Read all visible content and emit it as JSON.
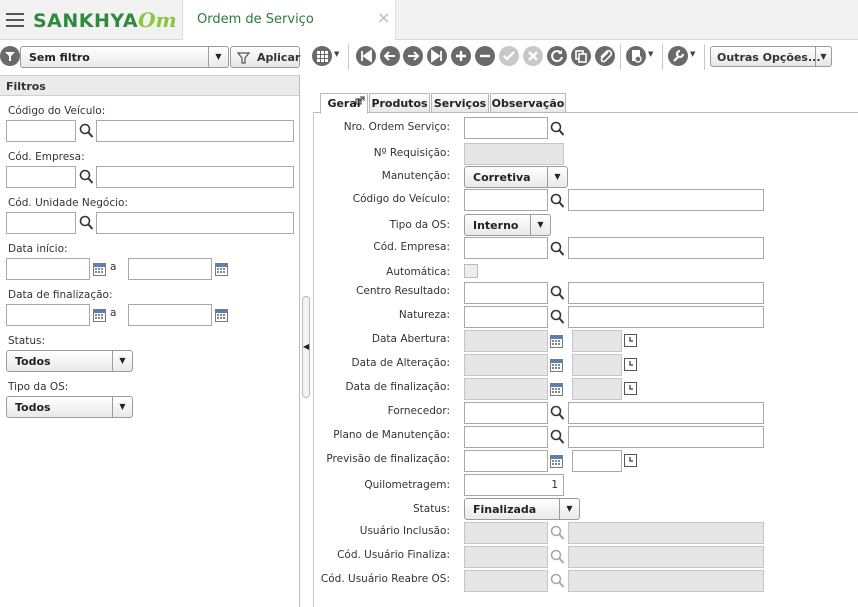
{
  "header": {
    "logo_text": "SANKHYA",
    "logo_accent": "Om",
    "tab_title": "Ordem de Serviço",
    "close_symbol": "×",
    "brand_color": "#2d8a3e"
  },
  "filterbar": {
    "filter_select": "Sem filtro",
    "apply_label": "Aplicar"
  },
  "toolbar": {
    "more_options_label": "Outras Opções..."
  },
  "left": {
    "panel_title": "Filtros",
    "codigo_veiculo_label": "Código do Veículo:",
    "cod_empresa_label": "Cód. Empresa:",
    "cod_unidade_label": "Cód. Unidade Negócio:",
    "data_inicio_label": "Data início:",
    "data_final_label": "Data de finalização:",
    "range_sep": "a",
    "status_label": "Status:",
    "status_value": "Todos",
    "tipo_os_label": "Tipo da OS:",
    "tipo_os_value": "Todos"
  },
  "tabs": [
    "Geral",
    "Produtos",
    "Serviços",
    "Observação"
  ],
  "form": {
    "nro_ordem_label": "Nro. Ordem Serviço:",
    "requisicao_label": "Nº Requisição:",
    "manutencao_label": "Manutenção:",
    "manutencao_value": "Corretiva",
    "codigo_veiculo_label": "Código do Veículo:",
    "tipo_os_label": "Tipo da OS:",
    "tipo_os_value": "Interno",
    "cod_empresa_label": "Cód. Empresa:",
    "automatica_label": "Automática:",
    "centro_resultado_label": "Centro Resultado:",
    "natureza_label": "Natureza:",
    "data_abertura_label": "Data Abertura:",
    "data_alteracao_label": "Data de Alteração:",
    "data_finalizacao_label": "Data de finalização:",
    "fornecedor_label": "Fornecedor:",
    "plano_label": "Plano de Manutenção:",
    "previsao_label": "Previsão de finalização:",
    "quilometragem_label": "Quilometragem:",
    "quilometragem_value": "1",
    "status_label": "Status:",
    "status_value": "Finalizada",
    "usuario_inclusao_label": "Usuário Inclusão:",
    "usuario_finaliza_label": "Cód. Usuário Finaliza:",
    "usuario_reabre_label": "Cód. Usuário Reabre OS:"
  }
}
